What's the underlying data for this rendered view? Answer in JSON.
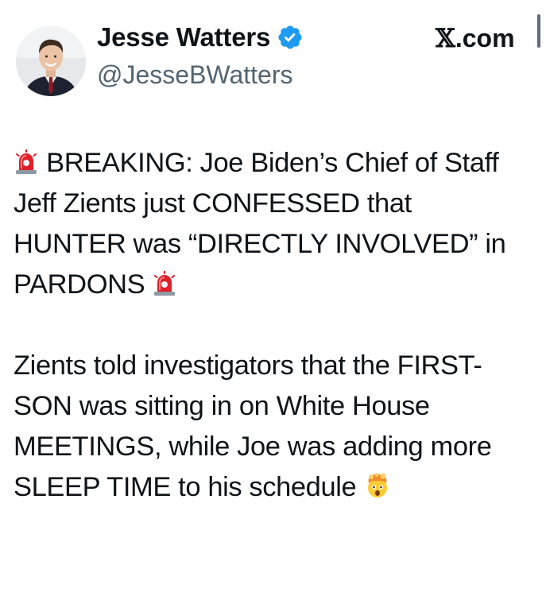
{
  "author": {
    "display_name": "Jesse Watters",
    "handle": "@JesseBWatters",
    "verified_icon": "verified-badge-icon",
    "verified_color": "#1d9bf0"
  },
  "site": {
    "label": ".com",
    "x_glyph": "𝕏"
  },
  "tweet": {
    "paragraph_1": {
      "lead_emoji": "rotating-light-icon",
      "text": " BREAKING: Joe Biden’s Chief of Staff Jeff Zients just CONFESSED that HUNTER was “DIRECTLY INVOLVED” in PARDONS ",
      "trail_emoji": "rotating-light-icon"
    },
    "paragraph_2": {
      "text": "Zients told investigators that the FIRST-SON was sitting in on White House MEETINGS, while Joe was adding more SLEEP TIME to his schedule ",
      "trail_emoji": "exploding-head-icon"
    }
  },
  "colors": {
    "text": "#0f1419",
    "secondary_text": "#536471",
    "background": "#ffffff",
    "alarm_red": "#e0202a"
  }
}
